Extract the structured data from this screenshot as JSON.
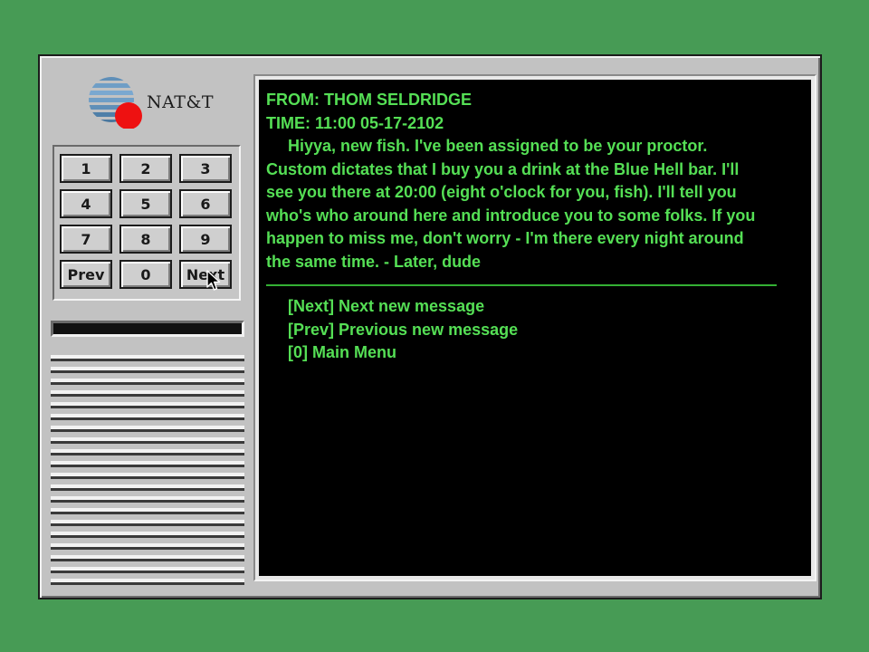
{
  "logo": {
    "brand": "NAT&T"
  },
  "keypad": {
    "keys": [
      "1",
      "2",
      "3",
      "4",
      "5",
      "6",
      "7",
      "8",
      "9",
      "Prev",
      "0",
      "Next"
    ]
  },
  "message": {
    "from": "FROM: THOM SELDRIDGE",
    "time": "TIME: 11:00 05-17-2102",
    "body_lines": [
      "Hiyya, new fish. I've been assigned to be your proctor.",
      "Custom dictates that I buy you a drink at the Blue Hell bar. I'll",
      "see you there at 20:00 (eight o'clock for you, fish). I'll tell you",
      "who's who around here and introduce you to some folks. If you",
      "happen to miss me, don't worry - I'm there every night around",
      "the same time. - Later, dude"
    ]
  },
  "menu": {
    "next": "[Next] Next new message",
    "prev": "[Prev] Previous new message",
    "main": "[0] Main Menu"
  },
  "colors": {
    "background": "#479b55",
    "terminal_text": "#55df55",
    "logo_dot": "#ee1111"
  }
}
